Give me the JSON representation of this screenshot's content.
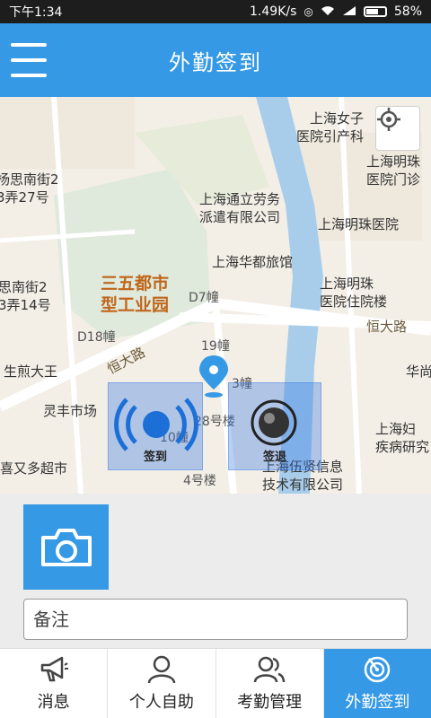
{
  "status_bar": {
    "time": "下午1:34",
    "speed": "1.49K/s",
    "battery": "58%"
  },
  "header": {
    "title": "外勤签到",
    "menu_icon": "hamburger-icon"
  },
  "map": {
    "labels": {
      "hospital_women": "上海女子\n医院引产科",
      "mingzhu_outpatient": "上海明珠\n医院门诊",
      "yangsi_27": "杨思南街2\n3弄27号",
      "tongli": "上海通立劳务\n派遣有限公司",
      "mingzhu_hospital": "上海明珠医院",
      "huadu": "上海华都旅馆",
      "yangsi_14": "思南街2\n3弄14号",
      "park": "三五都市\n型工业园",
      "d7": "D7幢",
      "mingzhu_inpatient": "上海明珠\n医院住院楼",
      "hengda_road_right": "恒大路",
      "d18": "D18幢",
      "b19": "19幢",
      "hengda_road_left": "恒大路",
      "shengjian": "生煎大王",
      "b13": "3幢",
      "hua": "华尚",
      "lingfeng": "灵丰市场",
      "b28": "28号楼",
      "b10": "10幢",
      "fuchan": "上海妇\n疾病研究",
      "youduo": "喜又多超市",
      "b4": "4号楼",
      "wuxian": "上海伍贤信息\n技术有限公司"
    },
    "sign_in_label": "签到",
    "sign_out_label": "签退"
  },
  "form": {
    "camera_icon": "camera-icon",
    "remark_placeholder": "备注"
  },
  "tabs": [
    {
      "label": "消息",
      "icon": "megaphone-icon"
    },
    {
      "label": "个人自助",
      "icon": "person-icon"
    },
    {
      "label": "考勤管理",
      "icon": "people-icon"
    },
    {
      "label": "外勤签到",
      "icon": "radar-icon"
    }
  ],
  "colors": {
    "primary": "#3599e6",
    "status_bar": "#1d1d1d"
  }
}
